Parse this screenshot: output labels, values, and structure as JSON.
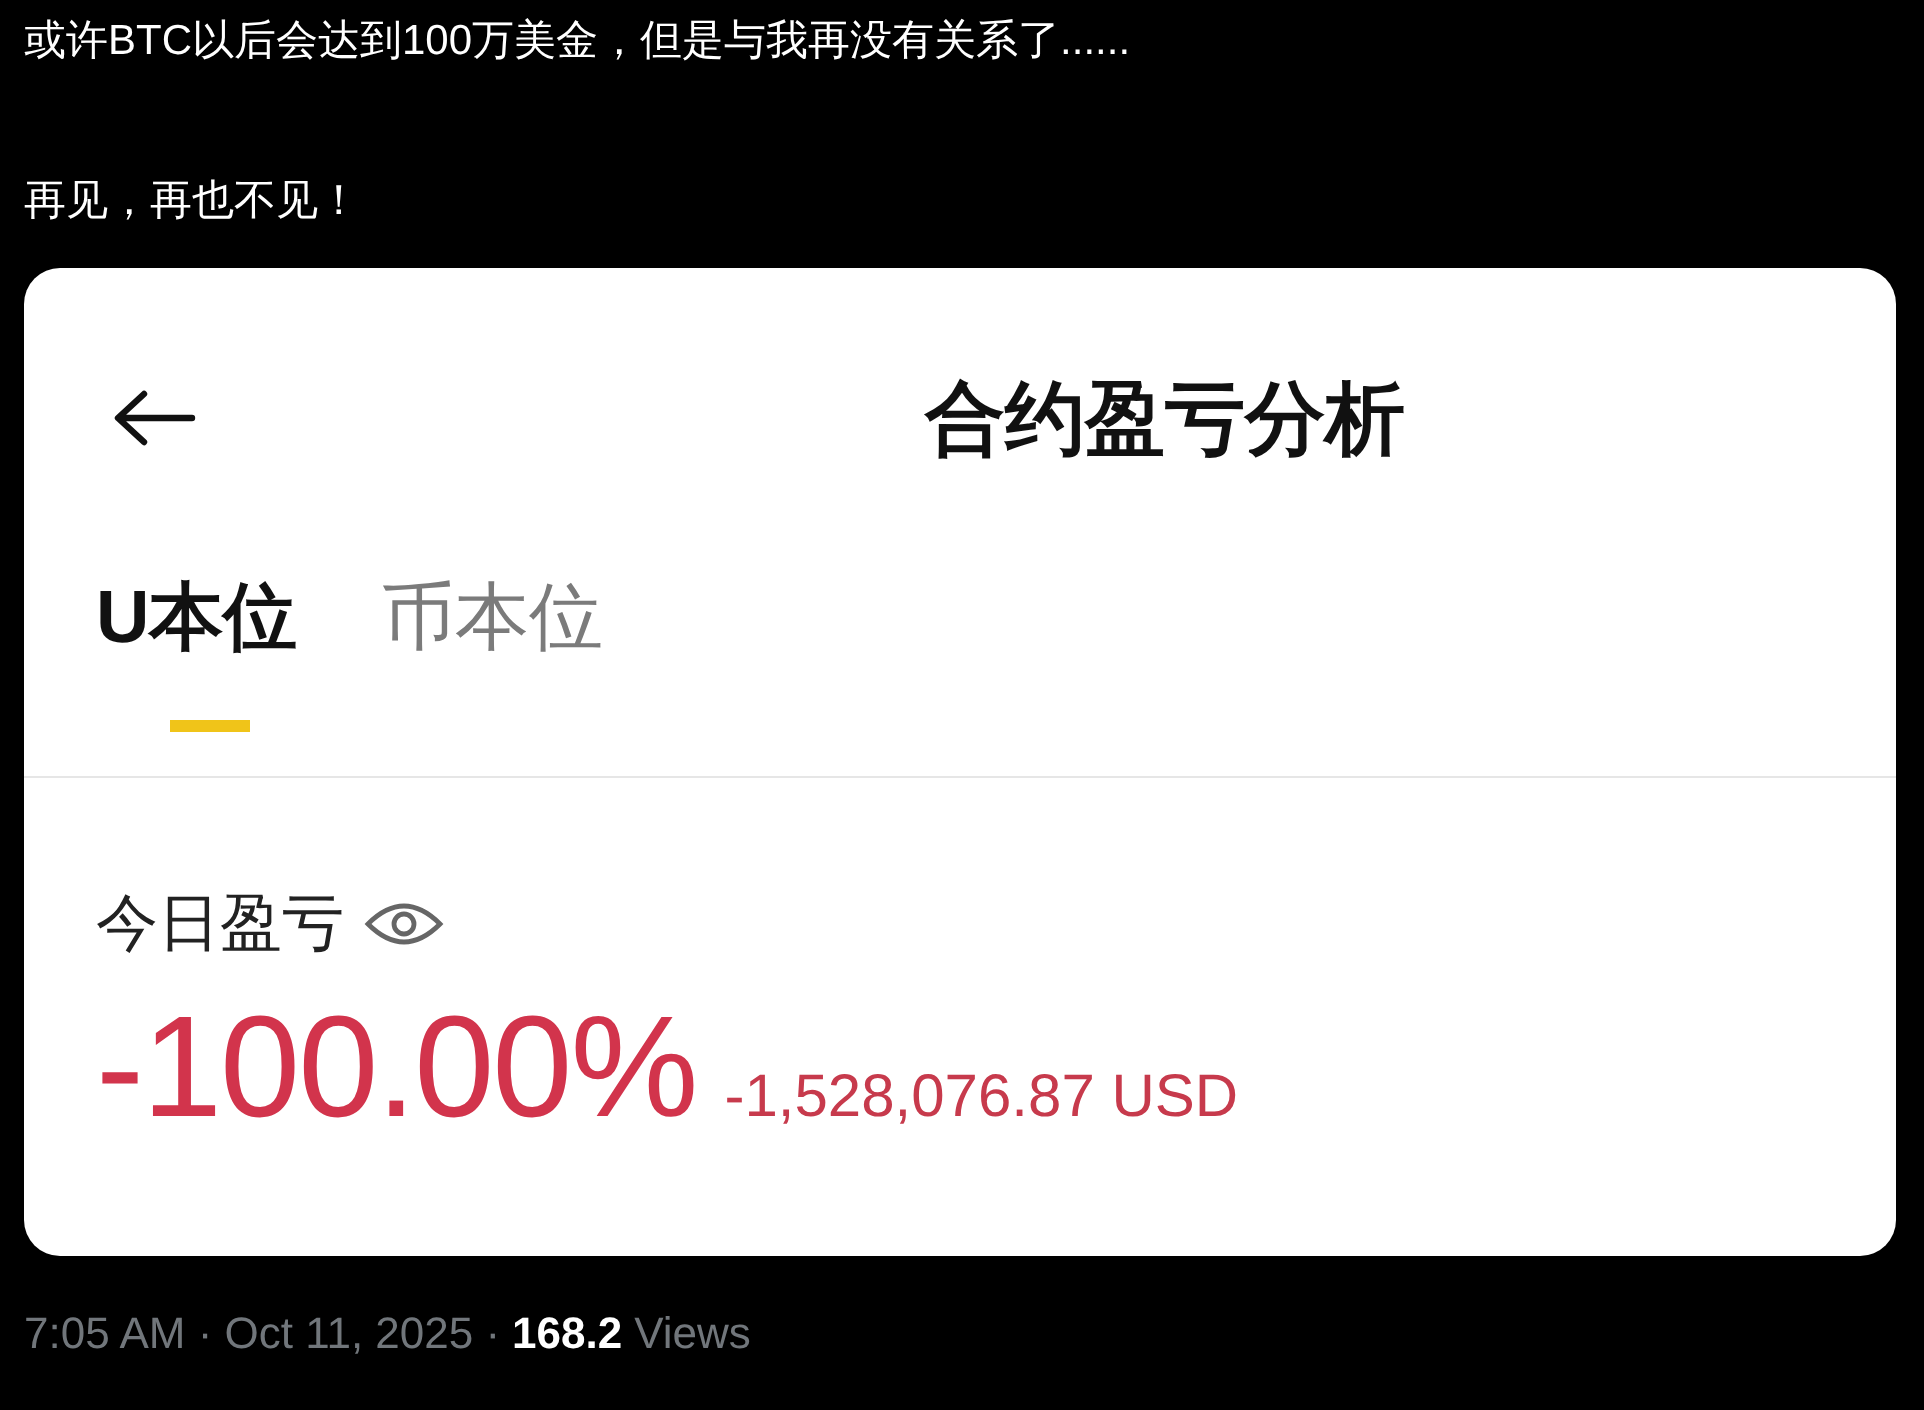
{
  "tweet": {
    "lines": [
      "或许BTC以后会达到100万美金，但是与我再没有关系了......",
      "再见，再也不见！"
    ]
  },
  "app_screen": {
    "title": "合约盈亏分析",
    "tabs": [
      {
        "label": "U本位",
        "selected": true
      },
      {
        "label": "币本位",
        "selected": false
      }
    ],
    "pnl": {
      "label": "今日盈亏",
      "percent": "-100.00%",
      "amount": "-1,528,076.87 USD"
    }
  },
  "meta": {
    "timestamp": "7:05 AM · Oct 11, 2025 ·",
    "views_count": "168.2",
    "views_label": "Views"
  }
}
